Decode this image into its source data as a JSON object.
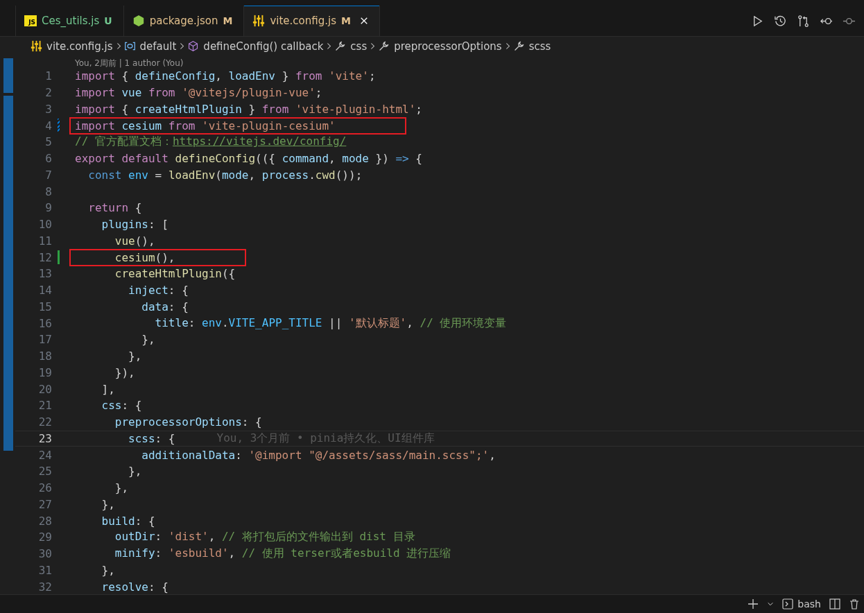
{
  "tabs": [
    {
      "label": "Ces_utils.js",
      "kind": "js",
      "icon_text": "JS",
      "status": "U",
      "selected": false
    },
    {
      "label": "package.json",
      "kind": "npm",
      "status": "M",
      "selected": false
    },
    {
      "label": "vite.config.js",
      "kind": "vite",
      "status": "M",
      "selected": true
    }
  ],
  "breadcrumb": [
    {
      "label": "vite.config.js",
      "kind": "vite"
    },
    {
      "label": "default",
      "kind": "module"
    },
    {
      "label": "defineConfig() callback",
      "kind": "function"
    },
    {
      "label": "css",
      "kind": "property"
    },
    {
      "label": "preprocessorOptions",
      "kind": "property"
    },
    {
      "label": "scss",
      "kind": "property"
    }
  ],
  "codelens": "You, 2周前 | 1 author (You)",
  "lines": [
    {
      "number": "1",
      "boxed": false,
      "current": false,
      "tokens": [
        {
          "kind": "kw",
          "text": "import"
        },
        {
          "kind": "plain",
          "text": " { "
        },
        {
          "kind": "var",
          "text": "defineConfig"
        },
        {
          "kind": "plain",
          "text": ", "
        },
        {
          "kind": "var",
          "text": "loadEnv"
        },
        {
          "kind": "plain",
          "text": " } "
        },
        {
          "kind": "kw",
          "text": "from"
        },
        {
          "kind": "str",
          "text": " 'vite'"
        },
        {
          "kind": "plain",
          "text": ";"
        }
      ]
    },
    {
      "number": "2",
      "boxed": false,
      "current": false,
      "tokens": [
        {
          "kind": "kw",
          "text": "import"
        },
        {
          "kind": "var",
          "text": " vue"
        },
        {
          "kind": "kw",
          "text": " from"
        },
        {
          "kind": "str",
          "text": " '@vitejs/plugin-vue'"
        },
        {
          "kind": "plain",
          "text": ";"
        }
      ]
    },
    {
      "number": "3",
      "boxed": false,
      "current": false,
      "tokens": [
        {
          "kind": "kw",
          "text": "import"
        },
        {
          "kind": "plain",
          "text": " { "
        },
        {
          "kind": "var",
          "text": "createHtmlPlugin"
        },
        {
          "kind": "plain",
          "text": " } "
        },
        {
          "kind": "kw",
          "text": "from"
        },
        {
          "kind": "str",
          "text": " 'vite-plugin-html'"
        },
        {
          "kind": "plain",
          "text": ";"
        }
      ]
    },
    {
      "number": "4",
      "boxed": true,
      "current": false,
      "marker": {
        "kind": "modified"
      },
      "tokens": [
        {
          "kind": "kw",
          "text": "import"
        },
        {
          "kind": "var",
          "text": " cesium"
        },
        {
          "kind": "kw",
          "text": " from"
        },
        {
          "kind": "str",
          "text": " 'vite-plugin-cesium'"
        }
      ]
    },
    {
      "number": "5",
      "boxed": false,
      "current": false,
      "tokens": [
        {
          "kind": "cmt",
          "text": "// 官方配置文档："
        },
        {
          "kind": "link",
          "text": "https://vitejs.dev/config/"
        }
      ]
    },
    {
      "number": "6",
      "boxed": false,
      "current": false,
      "tokens": [
        {
          "kind": "kw",
          "text": "export"
        },
        {
          "kind": "kw",
          "text": " default"
        },
        {
          "kind": "fn",
          "text": " defineConfig"
        },
        {
          "kind": "plain",
          "text": "(({ "
        },
        {
          "kind": "var",
          "text": "command"
        },
        {
          "kind": "plain",
          "text": ", "
        },
        {
          "kind": "var",
          "text": "mode"
        },
        {
          "kind": "plain",
          "text": " }) "
        },
        {
          "kind": "kwb",
          "text": "=>"
        },
        {
          "kind": "plain",
          "text": " {"
        }
      ]
    },
    {
      "number": "7",
      "boxed": false,
      "current": false,
      "tokens": [
        {
          "kind": "kwb",
          "text": "  const"
        },
        {
          "kind": "const",
          "text": " env"
        },
        {
          "kind": "plain",
          "text": " = "
        },
        {
          "kind": "fn",
          "text": "loadEnv"
        },
        {
          "kind": "plain",
          "text": "("
        },
        {
          "kind": "var",
          "text": "mode"
        },
        {
          "kind": "plain",
          "text": ", "
        },
        {
          "kind": "var",
          "text": "process"
        },
        {
          "kind": "plain",
          "text": "."
        },
        {
          "kind": "fn",
          "text": "cwd"
        },
        {
          "kind": "plain",
          "text": "());"
        }
      ]
    },
    {
      "number": "8",
      "boxed": false,
      "current": false
    },
    {
      "number": "9",
      "boxed": false,
      "current": false,
      "tokens": [
        {
          "kind": "kw",
          "text": "  return"
        },
        {
          "kind": "plain",
          "text": " {"
        }
      ]
    },
    {
      "number": "10",
      "boxed": false,
      "current": false,
      "tokens": [
        {
          "kind": "var",
          "text": "    plugins"
        },
        {
          "kind": "plain",
          "text": ": ["
        }
      ]
    },
    {
      "number": "11",
      "boxed": false,
      "current": false,
      "tokens": [
        {
          "kind": "fn",
          "text": "      vue"
        },
        {
          "kind": "plain",
          "text": "(),"
        }
      ]
    },
    {
      "number": "12",
      "boxed": true,
      "current": false,
      "marker": {
        "kind": "added"
      },
      "tokens": [
        {
          "kind": "fn",
          "text": "      cesium"
        },
        {
          "kind": "plain",
          "text": "(),"
        }
      ]
    },
    {
      "number": "13",
      "boxed": false,
      "current": false,
      "tokens": [
        {
          "kind": "fn",
          "text": "      createHtmlPlugin"
        },
        {
          "kind": "plain",
          "text": "({"
        }
      ]
    },
    {
      "number": "14",
      "boxed": false,
      "current": false,
      "tokens": [
        {
          "kind": "var",
          "text": "        inject"
        },
        {
          "kind": "plain",
          "text": ": {"
        }
      ]
    },
    {
      "number": "15",
      "boxed": false,
      "current": false,
      "tokens": [
        {
          "kind": "var",
          "text": "          data"
        },
        {
          "kind": "plain",
          "text": ": {"
        }
      ]
    },
    {
      "number": "16",
      "boxed": false,
      "current": false,
      "tokens": [
        {
          "kind": "var",
          "text": "            title"
        },
        {
          "kind": "plain",
          "text": ": "
        },
        {
          "kind": "const",
          "text": "env"
        },
        {
          "kind": "plain",
          "text": "."
        },
        {
          "kind": "const",
          "text": "VITE_APP_TITLE"
        },
        {
          "kind": "plain",
          "text": " || "
        },
        {
          "kind": "str",
          "text": "'默认标题'"
        },
        {
          "kind": "plain",
          "text": ", "
        },
        {
          "kind": "cmt",
          "text": "// 使用环境变量"
        }
      ]
    },
    {
      "number": "17",
      "boxed": false,
      "current": false,
      "tokens": [
        {
          "kind": "plain",
          "text": "          },"
        }
      ]
    },
    {
      "number": "18",
      "boxed": false,
      "current": false,
      "tokens": [
        {
          "kind": "plain",
          "text": "        },"
        }
      ]
    },
    {
      "number": "19",
      "boxed": false,
      "current": false,
      "tokens": [
        {
          "kind": "plain",
          "text": "      }),"
        }
      ]
    },
    {
      "number": "20",
      "boxed": false,
      "current": false,
      "tokens": [
        {
          "kind": "plain",
          "text": "    ],"
        }
      ]
    },
    {
      "number": "21",
      "boxed": false,
      "current": false,
      "tokens": [
        {
          "kind": "var",
          "text": "    css"
        },
        {
          "kind": "plain",
          "text": ": {"
        }
      ]
    },
    {
      "number": "22",
      "boxed": false,
      "current": false,
      "tokens": [
        {
          "kind": "var",
          "text": "      preprocessorOptions"
        },
        {
          "kind": "plain",
          "text": ": {"
        }
      ]
    },
    {
      "number": "23",
      "boxed": false,
      "current": true,
      "blame": "You, 3个月前 • pinia持久化、UI组件库",
      "tokens": [
        {
          "kind": "var",
          "text": "        scss"
        },
        {
          "kind": "plain",
          "text": ": {"
        }
      ]
    },
    {
      "number": "24",
      "boxed": false,
      "current": false,
      "tokens": [
        {
          "kind": "var",
          "text": "          additionalData"
        },
        {
          "kind": "plain",
          "text": ": "
        },
        {
          "kind": "str",
          "text": "'@import \"@/assets/sass/main.scss\";'"
        },
        {
          "kind": "plain",
          "text": ","
        }
      ]
    },
    {
      "number": "25",
      "boxed": false,
      "current": false,
      "tokens": [
        {
          "kind": "plain",
          "text": "        },"
        }
      ]
    },
    {
      "number": "26",
      "boxed": false,
      "current": false,
      "tokens": [
        {
          "kind": "plain",
          "text": "      },"
        }
      ]
    },
    {
      "number": "27",
      "boxed": false,
      "current": false,
      "tokens": [
        {
          "kind": "plain",
          "text": "    },"
        }
      ]
    },
    {
      "number": "28",
      "boxed": false,
      "current": false,
      "tokens": [
        {
          "kind": "var",
          "text": "    build"
        },
        {
          "kind": "plain",
          "text": ": {"
        }
      ]
    },
    {
      "number": "29",
      "boxed": false,
      "current": false,
      "tokens": [
        {
          "kind": "var",
          "text": "      outDir"
        },
        {
          "kind": "plain",
          "text": ": "
        },
        {
          "kind": "str",
          "text": "'dist'"
        },
        {
          "kind": "plain",
          "text": ", "
        },
        {
          "kind": "cmt",
          "text": "// 将打包后的文件输出到 dist 目录"
        }
      ]
    },
    {
      "number": "30",
      "boxed": false,
      "current": false,
      "tokens": [
        {
          "kind": "var",
          "text": "      minify"
        },
        {
          "kind": "plain",
          "text": ": "
        },
        {
          "kind": "str",
          "text": "'esbuild'"
        },
        {
          "kind": "plain",
          "text": ", "
        },
        {
          "kind": "cmt",
          "text": "// 使用 terser或者esbuild 进行压缩"
        }
      ]
    },
    {
      "number": "31",
      "boxed": false,
      "current": false,
      "tokens": [
        {
          "kind": "plain",
          "text": "    },"
        }
      ]
    },
    {
      "number": "32",
      "boxed": false,
      "current": false,
      "tokens": [
        {
          "kind": "var",
          "text": "    resolve"
        },
        {
          "kind": "plain",
          "text": ": {"
        }
      ]
    }
  ],
  "terminal": {
    "shell": "bash"
  }
}
